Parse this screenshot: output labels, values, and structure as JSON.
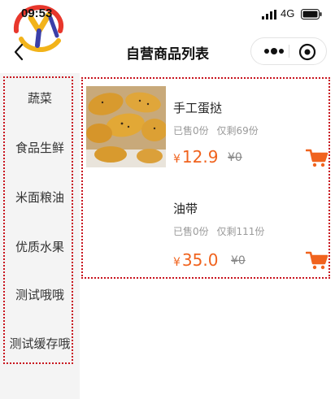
{
  "status": {
    "time": "09:53",
    "network": "4G"
  },
  "nav": {
    "title": "自营商品列表"
  },
  "sidebar": {
    "items": [
      {
        "label": "蔬菜"
      },
      {
        "label": "食品生鲜"
      },
      {
        "label": "米面粮油"
      },
      {
        "label": "优质水果"
      },
      {
        "label": "测试哦哦"
      },
      {
        "label": "测试缓存哦"
      }
    ]
  },
  "products": [
    {
      "name": "手工蛋挞",
      "sold": "已售0份",
      "stock": "仅剩69份",
      "currency": "¥",
      "price": "12.9",
      "old_price": "¥0"
    },
    {
      "name": "油带",
      "sold": "已售0份",
      "stock": "仅剩111份",
      "currency": "¥",
      "price": "35.0",
      "old_price": "¥0"
    }
  ],
  "colors": {
    "accent": "#f0631e",
    "highlight_border": "#c8141e",
    "sidebar_bg": "#f4f4f4"
  },
  "icons": {
    "cart": "cart-icon",
    "back": "back-arrow-icon",
    "more": "more-dots-icon",
    "close": "target-icon"
  }
}
